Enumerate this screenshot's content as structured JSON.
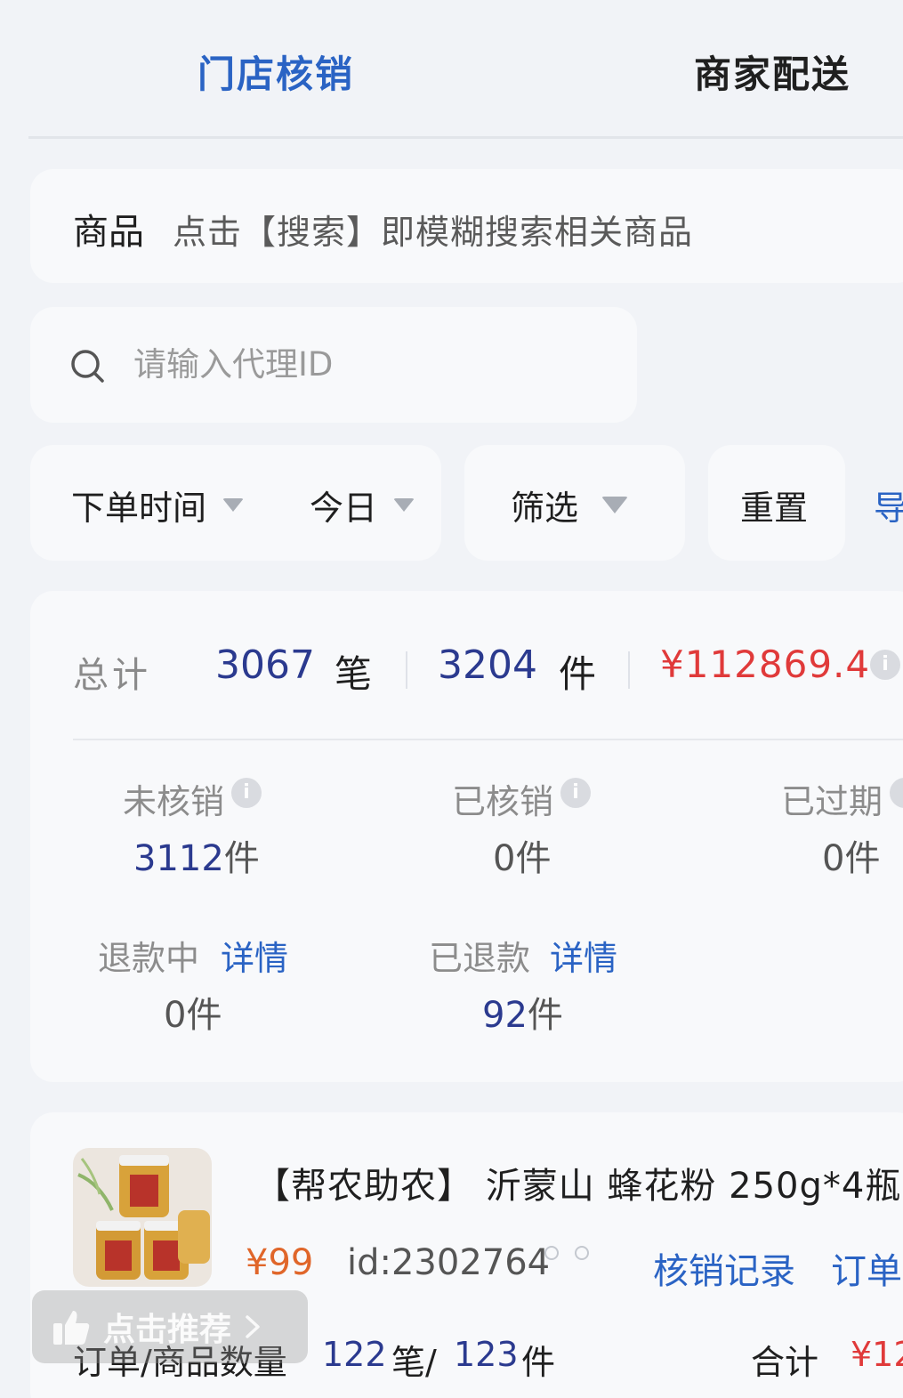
{
  "tabs": {
    "active": "门店核销",
    "other": "商家配送"
  },
  "product_search": {
    "label": "商品",
    "hint": "点击【搜索】即模糊搜索相关商品"
  },
  "agent_search": {
    "placeholder": "请输入代理ID",
    "icon": "search-icon"
  },
  "filters": {
    "time_field": "下单时间",
    "period": "今日",
    "screen": "筛选",
    "reset": "重置",
    "export": "导"
  },
  "totals": {
    "label": "总计",
    "orders": "3067",
    "orders_unit": "笔",
    "pieces": "3204",
    "pieces_unit": "件",
    "amount": "¥112869.4",
    "info": "i"
  },
  "status": {
    "pending": {
      "label": "未核销",
      "value": "3112",
      "unit": "件"
    },
    "verified": {
      "label": "已核销",
      "value": "0件"
    },
    "expired": {
      "label": "已过期",
      "value": "0件"
    },
    "refunding": {
      "label": "退款中",
      "link": "详情",
      "value": "0件"
    },
    "refunded": {
      "label": "已退款",
      "link": "详情",
      "value": "92",
      "unit": "件"
    }
  },
  "order": {
    "title": "【帮农助农】 沂蒙山 蜂花粉 250g*4瓶",
    "price": "¥99",
    "id": "id:2302764",
    "record_link": "核销记录",
    "order_link": "订单",
    "qty_label": "订单/商品数量",
    "qty_orders": "122",
    "qty_orders_unit": "笔/",
    "qty_pieces": "123",
    "qty_pieces_unit": "件",
    "sum_label": "合计",
    "sum": "¥12"
  },
  "recommend": {
    "label": "点击推荐"
  },
  "colors": {
    "accent": "#2a63c4",
    "number": "#2b3a8f",
    "price_red": "#e03a3a",
    "price_orange": "#e0662a"
  }
}
